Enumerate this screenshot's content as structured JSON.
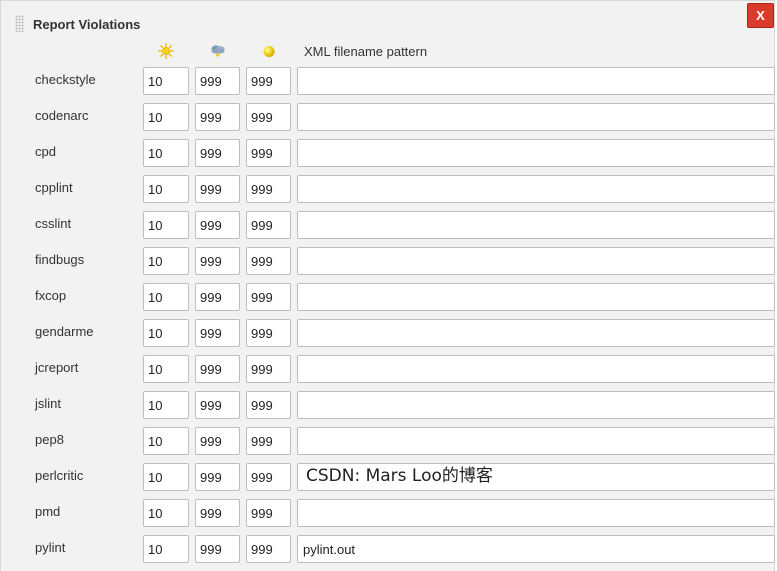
{
  "header": {
    "title": "Report Violations",
    "close_label": "X"
  },
  "columns": {
    "sunny_icon": "sun-icon",
    "stormy_icon": "storm-cloud-icon",
    "unstable_icon": "yellow-ball-icon",
    "pattern_label": "XML filename pattern"
  },
  "colors": {
    "close_button": "#d93a2b",
    "sun": "#f5c400",
    "storm": "#6d8fb0",
    "ball": "#f1d21c"
  },
  "violations": [
    {
      "name": "checkstyle",
      "min": "10",
      "max": "999",
      "unstable": "999",
      "pattern": ""
    },
    {
      "name": "codenarc",
      "min": "10",
      "max": "999",
      "unstable": "999",
      "pattern": ""
    },
    {
      "name": "cpd",
      "min": "10",
      "max": "999",
      "unstable": "999",
      "pattern": ""
    },
    {
      "name": "cpplint",
      "min": "10",
      "max": "999",
      "unstable": "999",
      "pattern": ""
    },
    {
      "name": "csslint",
      "min": "10",
      "max": "999",
      "unstable": "999",
      "pattern": ""
    },
    {
      "name": "findbugs",
      "min": "10",
      "max": "999",
      "unstable": "999",
      "pattern": ""
    },
    {
      "name": "fxcop",
      "min": "10",
      "max": "999",
      "unstable": "999",
      "pattern": ""
    },
    {
      "name": "gendarme",
      "min": "10",
      "max": "999",
      "unstable": "999",
      "pattern": ""
    },
    {
      "name": "jcreport",
      "min": "10",
      "max": "999",
      "unstable": "999",
      "pattern": ""
    },
    {
      "name": "jslint",
      "min": "10",
      "max": "999",
      "unstable": "999",
      "pattern": ""
    },
    {
      "name": "pep8",
      "min": "10",
      "max": "999",
      "unstable": "999",
      "pattern": ""
    },
    {
      "name": "perlcritic",
      "min": "10",
      "max": "999",
      "unstable": "999",
      "pattern": ""
    },
    {
      "name": "pmd",
      "min": "10",
      "max": "999",
      "unstable": "999",
      "pattern": ""
    },
    {
      "name": "pylint",
      "min": "10",
      "max": "999",
      "unstable": "999",
      "pattern": "pylint.out"
    }
  ],
  "watermark": "CSDN: Mars Loo的博客"
}
